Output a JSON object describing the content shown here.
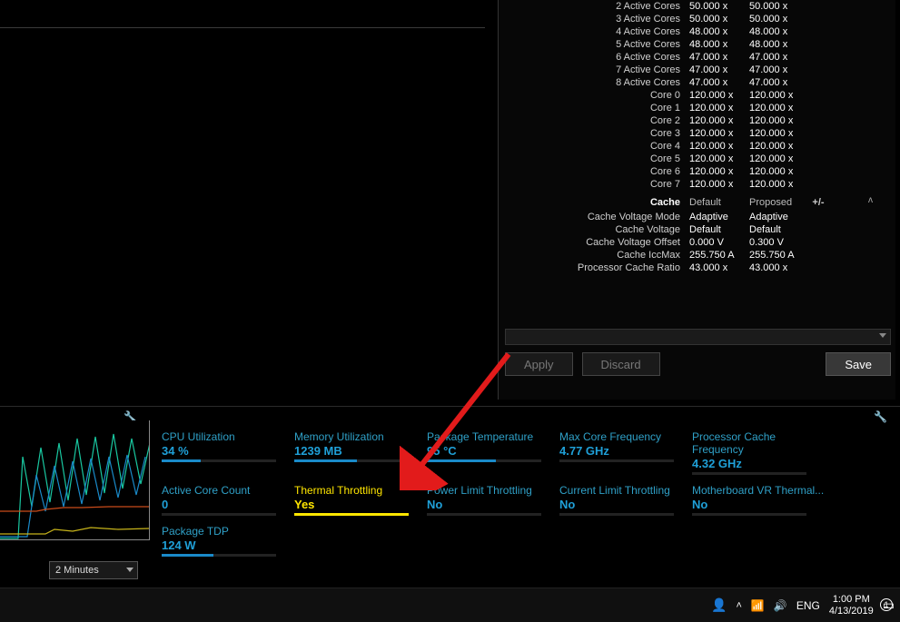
{
  "settings": {
    "cores_header": {
      "label": "",
      "v1": "",
      "v2": ""
    },
    "rows": [
      {
        "lbl": "2 Active Cores",
        "v1": "50.000 x",
        "v2": "50.000 x"
      },
      {
        "lbl": "3 Active Cores",
        "v1": "50.000 x",
        "v2": "50.000 x"
      },
      {
        "lbl": "4 Active Cores",
        "v1": "48.000 x",
        "v2": "48.000 x"
      },
      {
        "lbl": "5 Active Cores",
        "v1": "48.000 x",
        "v2": "48.000 x"
      },
      {
        "lbl": "6 Active Cores",
        "v1": "47.000 x",
        "v2": "47.000 x"
      },
      {
        "lbl": "7 Active Cores",
        "v1": "47.000 x",
        "v2": "47.000 x"
      },
      {
        "lbl": "8 Active Cores",
        "v1": "47.000 x",
        "v2": "47.000 x"
      },
      {
        "lbl": "Core 0",
        "v1": "120.000 x",
        "v2": "120.000 x"
      },
      {
        "lbl": "Core 1",
        "v1": "120.000 x",
        "v2": "120.000 x"
      },
      {
        "lbl": "Core 2",
        "v1": "120.000 x",
        "v2": "120.000 x"
      },
      {
        "lbl": "Core 3",
        "v1": "120.000 x",
        "v2": "120.000 x"
      },
      {
        "lbl": "Core 4",
        "v1": "120.000 x",
        "v2": "120.000 x"
      },
      {
        "lbl": "Core 5",
        "v1": "120.000 x",
        "v2": "120.000 x"
      },
      {
        "lbl": "Core 6",
        "v1": "120.000 x",
        "v2": "120.000 x"
      },
      {
        "lbl": "Core 7",
        "v1": "120.000 x",
        "v2": "120.000 x"
      }
    ],
    "cache_header": {
      "lbl": "Cache",
      "v1": "Default",
      "v2": "Proposed",
      "pm": "+/-"
    },
    "cache_rows": [
      {
        "lbl": "Cache Voltage Mode",
        "v1": "Adaptive",
        "v2": "Adaptive"
      },
      {
        "lbl": "Cache Voltage",
        "v1": "Default",
        "v2": "Default"
      },
      {
        "lbl": "Cache Voltage Offset",
        "v1": "0.000 V",
        "v2": "0.300 V"
      },
      {
        "lbl": "Cache IccMax",
        "v1": "255.750 A",
        "v2": "255.750 A"
      },
      {
        "lbl": "Processor Cache Ratio",
        "v1": "43.000 x",
        "v2": "43.000 x"
      }
    ]
  },
  "buttons": {
    "apply": "Apply",
    "discard": "Discard",
    "save": "Save"
  },
  "status": {
    "time_range": "2 Minutes",
    "metrics": [
      {
        "label": "CPU Utilization",
        "value": "34 %",
        "fill": 34,
        "color": "blue"
      },
      {
        "label": "Memory Utilization",
        "value": "1239  MB",
        "fill": 55,
        "color": "blue"
      },
      {
        "label": "Package Temperature",
        "value": "95 °C",
        "fill": 60,
        "color": "blue"
      },
      {
        "label": "Max Core Frequency",
        "value": "4.77 GHz",
        "fill": 0,
        "color": "blue"
      },
      {
        "label": "Processor Cache Frequency",
        "value": "4.32 GHz",
        "fill": 0,
        "color": "blue"
      },
      {
        "label": "Active Core Count",
        "value": "0",
        "fill": 0,
        "color": "blue"
      },
      {
        "label": "Thermal Throttling",
        "value": "Yes",
        "fill": 100,
        "color": "yellow"
      },
      {
        "label": "Power Limit Throttling",
        "value": "No",
        "fill": 0,
        "color": "blue"
      },
      {
        "label": "Current Limit Throttling",
        "value": "No",
        "fill": 0,
        "color": "blue"
      },
      {
        "label": "Motherboard VR Thermal...",
        "value": "No",
        "fill": 0,
        "color": "blue"
      },
      {
        "label": "Package TDP",
        "value": "124 W",
        "fill": 45,
        "color": "blue"
      }
    ]
  },
  "taskbar": {
    "lang": "ENG",
    "time": "1:00 PM",
    "date": "4/13/2019"
  }
}
